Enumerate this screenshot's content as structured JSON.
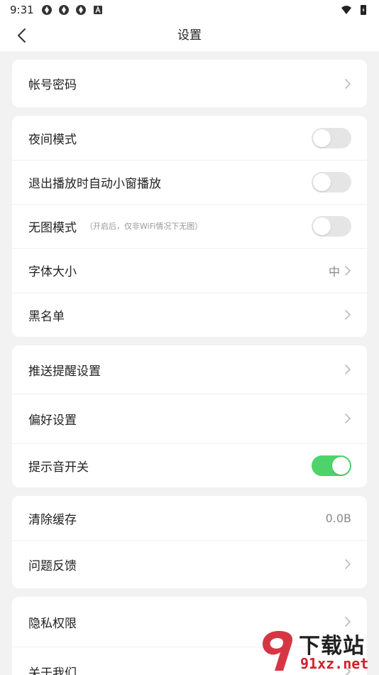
{
  "status_bar": {
    "time": "9:31",
    "left_icons": [
      "app-notification-icon",
      "app-notification-icon",
      "app-notification-icon",
      "a-badge-icon"
    ],
    "right_icons": [
      "wifi-icon",
      "battery-icon"
    ]
  },
  "nav": {
    "title": "设置",
    "back_icon": "back-arrow-icon"
  },
  "sections": [
    {
      "rows": [
        {
          "label": "帐号密码",
          "control": "chevron"
        }
      ]
    },
    {
      "rows": [
        {
          "label": "夜间模式",
          "control": "toggle",
          "checked": false
        },
        {
          "label": "退出播放时自动小窗播放",
          "control": "toggle",
          "checked": false
        },
        {
          "label": "无图模式",
          "hint": "（开启后，仅非WiFi情况下无图）",
          "control": "toggle",
          "checked": false
        },
        {
          "label": "字体大小",
          "value": "中",
          "control": "chevron"
        },
        {
          "label": "黑名单",
          "control": "chevron"
        }
      ]
    },
    {
      "rows": [
        {
          "label": "推送提醒设置",
          "control": "chevron"
        },
        {
          "label": "偏好设置",
          "control": "chevron"
        },
        {
          "label": "提示音开关",
          "control": "toggle",
          "checked": true
        }
      ]
    },
    {
      "rows": [
        {
          "label": "清除缓存",
          "value": "0.0B",
          "control": "value"
        },
        {
          "label": "问题反馈",
          "control": "chevron"
        }
      ]
    },
    {
      "rows": [
        {
          "label": "隐私权限",
          "control": "chevron"
        },
        {
          "label": "关于我们",
          "control": "chevron"
        }
      ]
    }
  ],
  "watermark": {
    "title": "下载站",
    "url": "91xz.net"
  },
  "colors": {
    "toggle_on": "#4ed36b",
    "toggle_off": "#e5e5e5",
    "background": "#f2f2f2",
    "card": "#ffffff"
  }
}
